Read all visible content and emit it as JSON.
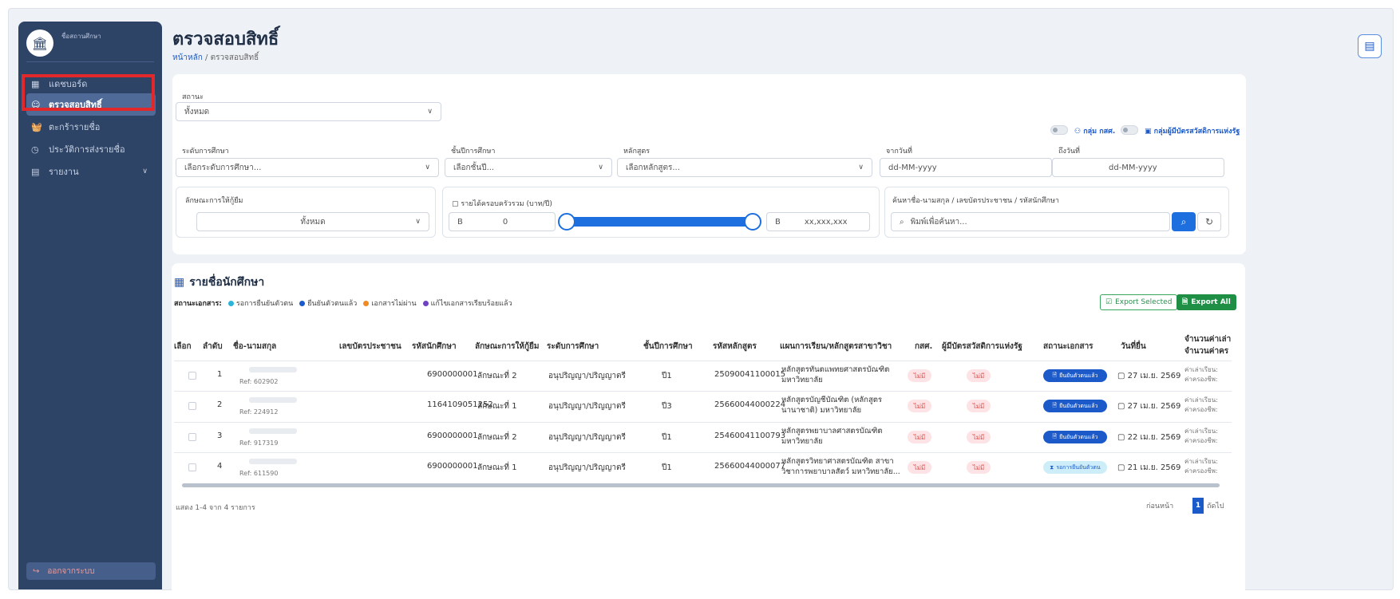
{
  "sidebar": {
    "school_name": "ชื่อสถานศึกษา",
    "items": [
      {
        "label": "แดชบอร์ด",
        "icon": "grid-icon"
      },
      {
        "label": "ตรวจสอบสิทธิ์",
        "icon": "user-check-icon"
      },
      {
        "label": "ตะกร้ารายชื่อ",
        "icon": "basket-icon"
      },
      {
        "label": "ประวัติการส่งรายชื่อ",
        "icon": "history-icon"
      },
      {
        "label": "รายงาน",
        "icon": "report-icon"
      }
    ],
    "logout_label": "ออกจากระบบ"
  },
  "header": {
    "title": "ตรวจสอบสิทธิ์",
    "breadcrumb_home": "หน้าหลัก",
    "breadcrumb_sep": "/",
    "breadcrumb_current": "ตรวจสอบสิทธิ์"
  },
  "filters": {
    "status_label": "สถานะ",
    "status_value": "ทั้งหมด",
    "toggle_gsf_label": "กลุ่ม กสศ.",
    "toggle_welfare_label": "กลุ่มผู้มีบัตรสวัสดิการแห่งรัฐ",
    "level_label": "ระดับการศึกษา",
    "level_placeholder": "เลือกระดับการศึกษา...",
    "year_label": "ชั้นปีการศึกษา",
    "year_placeholder": "เลือกชั้นปี...",
    "course_label": "หลักสูตร",
    "course_placeholder": "เลือกหลักสูตร...",
    "from_label": "จากวันที่",
    "from_placeholder": "dd-MM-yyyy",
    "to_label": "ถึงวันที่",
    "to_placeholder": "dd-MM-yyyy",
    "loan_type_label": "ลักษณะการให้กู้ยืม",
    "loan_type_value": "ทั้งหมด",
    "income_label": "รายได้ครอบครัวรวม (บาท/ปี)",
    "income_prefix": "B",
    "income_min": "0",
    "income_max": "xx,xxx,xxx",
    "search_label": "ค้นหาชื่อ-นามสกุล / เลขบัตรประชาชน / รหัสนักศึกษา",
    "search_placeholder": "พิมพ์เพื่อค้นหา..."
  },
  "list": {
    "title": "รายชื่อนักศึกษา",
    "legend_title": "สถานะเอกสาร:",
    "legend": [
      {
        "label": "รอการยืนยันตัวตน",
        "color": "#28b5d8"
      },
      {
        "label": "ยืนยันตัวตนแล้ว",
        "color": "#1d5ac9"
      },
      {
        "label": "เอกสารไม่ผ่าน",
        "color": "#f08a24"
      },
      {
        "label": "แก้ไขเอกสารเรียบร้อยแล้ว",
        "color": "#6f42c1"
      }
    ],
    "export_selected": "Export Selected",
    "export_all": "Export All",
    "columns": {
      "select": "เลือก",
      "no": "ลำดับ",
      "name": "ชื่อ-นามสกุล",
      "citizen_id": "เลขบัตรประชาชน",
      "student_id": "รหัสนักศึกษา",
      "loan_type": "ลักษณะการให้กู้ยืม",
      "level": "ระดับการศึกษา",
      "year": "ชั้นปีการศึกษา",
      "course_code": "รหัสหลักสูตร",
      "plan": "แผนการเรียน/หลักสูตรสาขาวิชา",
      "gsf": "กสศ.",
      "welfare": "ผู้มีบัตรสวัสดิการแห่งรัฐ",
      "doc_status": "สถานะเอกสาร",
      "submit_date": "วันที่ยื่น",
      "amount_1": "จำนวนค่าเล่า",
      "amount_2": "จำนวนค่าคร"
    },
    "rows": [
      {
        "no": "1",
        "ref": "Ref: 602902",
        "student_id": "6900000001",
        "loan_type": "ลักษณะที่ 2",
        "level": "อนุปริญญา/ปริญญาตรี",
        "year": "ปี1",
        "course_code": "25090041100015",
        "plan": "หลักสูตรทันตแพทยศาสตรบัณฑิต มหาวิทยาลัย",
        "gsf": "ไม่มี",
        "welfare": "ไม่มี",
        "status": "ยืนยันตัวตนแล้ว",
        "status_kind": "ok",
        "date": "27 เม.ย. 2569",
        "fee1": "ค่าเล่าเรียน:",
        "fee2": "ค่าครองชีพ:"
      },
      {
        "no": "2",
        "ref": "Ref: 224912",
        "student_id": "1164109051252",
        "loan_type": "ลักษณะที่ 1",
        "level": "อนุปริญญา/ปริญญาตรี",
        "year": "ปี3",
        "course_code": "25660044000224",
        "plan": "หลักสูตรบัญชีบัณฑิต (หลักสูตรนานาชาติ) มหาวิทยาลัย",
        "gsf": "ไม่มี",
        "welfare": "ไม่มี",
        "status": "ยืนยันตัวตนแล้ว",
        "status_kind": "ok",
        "date": "27 เม.ย. 2569",
        "fee1": "ค่าเล่าเรียน:",
        "fee2": "ค่าครองชีพ:"
      },
      {
        "no": "3",
        "ref": "Ref: 917319",
        "student_id": "6900000001",
        "loan_type": "ลักษณะที่ 2",
        "level": "อนุปริญญา/ปริญญาตรี",
        "year": "ปี1",
        "course_code": "25460041100793",
        "plan": "หลักสูตรพยาบาลศาสตรบัณฑิต มหาวิทยาลัย",
        "gsf": "ไม่มี",
        "welfare": "ไม่มี",
        "status": "ยืนยันตัวตนแล้ว",
        "status_kind": "ok",
        "date": "22 เม.ย. 2569",
        "fee1": "ค่าเล่าเรียน:",
        "fee2": "ค่าครองชีพ:"
      },
      {
        "no": "4",
        "ref": "Ref: 611590",
        "student_id": "6900000001",
        "loan_type": "ลักษณะที่ 1",
        "level": "อนุปริญญา/ปริญญาตรี",
        "year": "ปี1",
        "course_code": "25660044000077",
        "plan": "หลักสูตรวิทยาศาสตรบัณฑิต สาขาวิชาการพยาบาลสัตว์ มหาวิทยาลัย...",
        "gsf": "ไม่มี",
        "welfare": "ไม่มี",
        "status": "รอการยืนยันตัวตน",
        "status_kind": "wait",
        "date": "21 เม.ย. 2569",
        "fee1": "ค่าเล่าเรียน:",
        "fee2": "ค่าครองชีพ:"
      }
    ],
    "footer": "แสดง 1-4 จาก 4 รายการ",
    "prev": "ก่อนหน้า",
    "page": "1",
    "next": "ถัดไป"
  },
  "colors": {
    "sidebar": "#2e4467",
    "primary": "#1d5ac9",
    "success": "#1f8f45",
    "highlight": "#e3282b"
  }
}
